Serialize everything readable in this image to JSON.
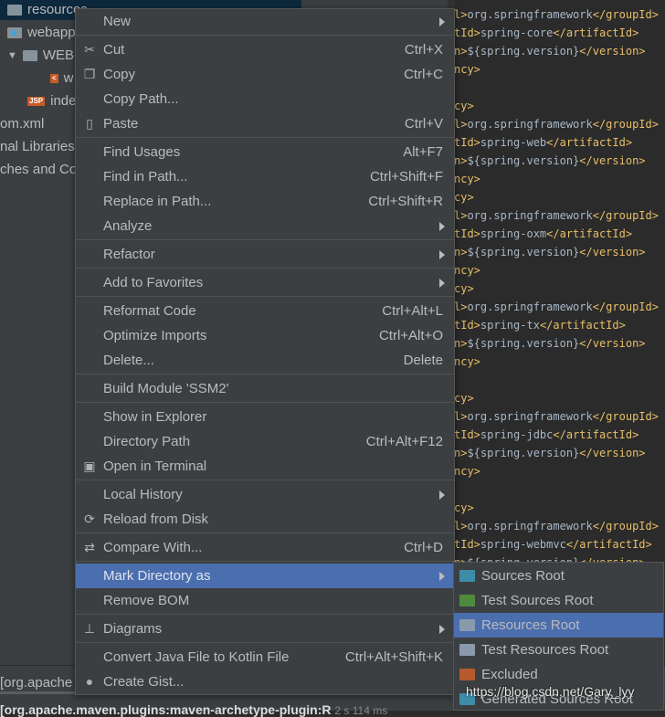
{
  "tree": [
    {
      "label": "resources",
      "icon": "folder-icon",
      "selected": true
    },
    {
      "label": "webapp",
      "icon": "web-folder-icon"
    },
    {
      "label": "WEB-INF",
      "icon": "folder-icon",
      "expanded": true
    },
    {
      "label": "w",
      "icon": "xml-file-icon"
    },
    {
      "label": "inde",
      "icon": "jsp-file-icon",
      "badge": "JSP"
    },
    {
      "label": "om.xml"
    },
    {
      "label": "nal Libraries"
    },
    {
      "label": "ches and Co"
    }
  ],
  "editor_lines": [
    [
      "l>",
      "org.springframework",
      "</groupId>"
    ],
    [
      "tId>",
      "spring-core",
      "</artifactId>"
    ],
    [
      "n>",
      "${spring.version}",
      "</version>"
    ],
    [
      "ncy>",
      "",
      ""
    ],
    [
      "",
      "",
      ""
    ],
    [
      "cy>",
      "",
      ""
    ],
    [
      "l>",
      "org.springframework",
      "</groupId>"
    ],
    [
      "tId>",
      "spring-web",
      "</artifactId>"
    ],
    [
      "n>",
      "${spring.version}",
      "</version>"
    ],
    [
      "ncy>",
      "",
      ""
    ],
    [
      "cy>",
      "",
      ""
    ],
    [
      "l>",
      "org.springframework",
      "</groupId>"
    ],
    [
      "tId>",
      "spring-oxm",
      "</artifactId>"
    ],
    [
      "n>",
      "${spring.version}",
      "</version>"
    ],
    [
      "ncy>",
      "",
      ""
    ],
    [
      "cy>",
      "",
      ""
    ],
    [
      "l>",
      "org.springframework",
      "</groupId>"
    ],
    [
      "tId>",
      "spring-tx",
      "</artifactId>"
    ],
    [
      "n>",
      "${spring.version}",
      "</version>"
    ],
    [
      "ncy>",
      "",
      ""
    ],
    [
      "",
      "",
      ""
    ],
    [
      "cy>",
      "",
      ""
    ],
    [
      "l>",
      "org.springframework",
      "</groupId>"
    ],
    [
      "tId>",
      "spring-jdbc",
      "</artifactId>"
    ],
    [
      "n>",
      "${spring.version}",
      "</version>"
    ],
    [
      "ncy>",
      "",
      ""
    ],
    [
      "",
      "",
      ""
    ],
    [
      "cy>",
      "",
      ""
    ],
    [
      "l>",
      "org.springframework",
      "</groupId>"
    ],
    [
      "tId>",
      "spring-webmvc",
      "</artifactId>"
    ],
    [
      "n>",
      "${spring.version}",
      "</version>"
    ]
  ],
  "menu": [
    {
      "label": "New",
      "submenu": true
    },
    {
      "sep": true
    },
    {
      "label": "Cut",
      "shortcut": "Ctrl+X",
      "icon": "scissors-icon",
      "glyph": "✂"
    },
    {
      "label": "Copy",
      "shortcut": "Ctrl+C",
      "icon": "copy-icon",
      "glyph": "❐"
    },
    {
      "label": "Copy Path...",
      "shortcut": ""
    },
    {
      "label": "Paste",
      "shortcut": "Ctrl+V",
      "icon": "clipboard-icon",
      "glyph": "▯"
    },
    {
      "sep": true
    },
    {
      "label": "Find Usages",
      "shortcut": "Alt+F7"
    },
    {
      "label": "Find in Path...",
      "shortcut": "Ctrl+Shift+F"
    },
    {
      "label": "Replace in Path...",
      "shortcut": "Ctrl+Shift+R"
    },
    {
      "label": "Analyze",
      "submenu": true
    },
    {
      "sep": true
    },
    {
      "label": "Refactor",
      "submenu": true
    },
    {
      "sep": true
    },
    {
      "label": "Add to Favorites",
      "submenu": true
    },
    {
      "sep": true
    },
    {
      "label": "Reformat Code",
      "shortcut": "Ctrl+Alt+L"
    },
    {
      "label": "Optimize Imports",
      "shortcut": "Ctrl+Alt+O"
    },
    {
      "label": "Delete...",
      "shortcut": "Delete"
    },
    {
      "sep": true
    },
    {
      "label": "Build Module 'SSM2'"
    },
    {
      "sep": true
    },
    {
      "label": "Show in Explorer"
    },
    {
      "label": "Directory Path",
      "shortcut": "Ctrl+Alt+F12"
    },
    {
      "label": "Open in Terminal",
      "icon": "terminal-icon",
      "glyph": "▣"
    },
    {
      "sep": true
    },
    {
      "label": "Local History",
      "submenu": true
    },
    {
      "label": "Reload from Disk",
      "icon": "reload-icon",
      "glyph": "⟳"
    },
    {
      "sep": true
    },
    {
      "label": "Compare With...",
      "shortcut": "Ctrl+D",
      "icon": "compare-icon",
      "glyph": "⇄"
    },
    {
      "sep": true
    },
    {
      "label": "Mark Directory as",
      "submenu": true,
      "highlighted": true
    },
    {
      "label": "Remove BOM"
    },
    {
      "sep": true
    },
    {
      "label": "Diagrams",
      "submenu": true,
      "icon": "diagram-icon",
      "glyph": "⊥"
    },
    {
      "sep": true
    },
    {
      "label": "Convert Java File to Kotlin File",
      "shortcut": "Ctrl+Alt+Shift+K"
    },
    {
      "label": "Create Gist...",
      "icon": "github-icon",
      "glyph": "●"
    }
  ],
  "submenu": [
    {
      "label": "Sources Root",
      "color": "#3d8ca8"
    },
    {
      "label": "Test Sources Root",
      "color": "#4e8a3e"
    },
    {
      "label": "Resources Root",
      "color": "#8a9aad",
      "highlighted": true
    },
    {
      "label": "Test Resources Root",
      "color": "#8a9aad"
    },
    {
      "label": "Excluded",
      "color": "#b45a2e"
    },
    {
      "label": "Generated Sources Root",
      "color": "#3d8ca8"
    }
  ],
  "bottom": {
    "line1": "[org.apache",
    "line2": "[org.apache.maven.plugins:maven-archetype-plugin:R",
    "time": "2 s 114 ms"
  },
  "watermark": "https://blog.csdn.net/Gary_lyy",
  "colors": {
    "menu_bg": "#3c3f41",
    "highlight": "#4b6eaf",
    "editor_bg": "#2b2b2b",
    "tag": "#e8bf6a"
  }
}
